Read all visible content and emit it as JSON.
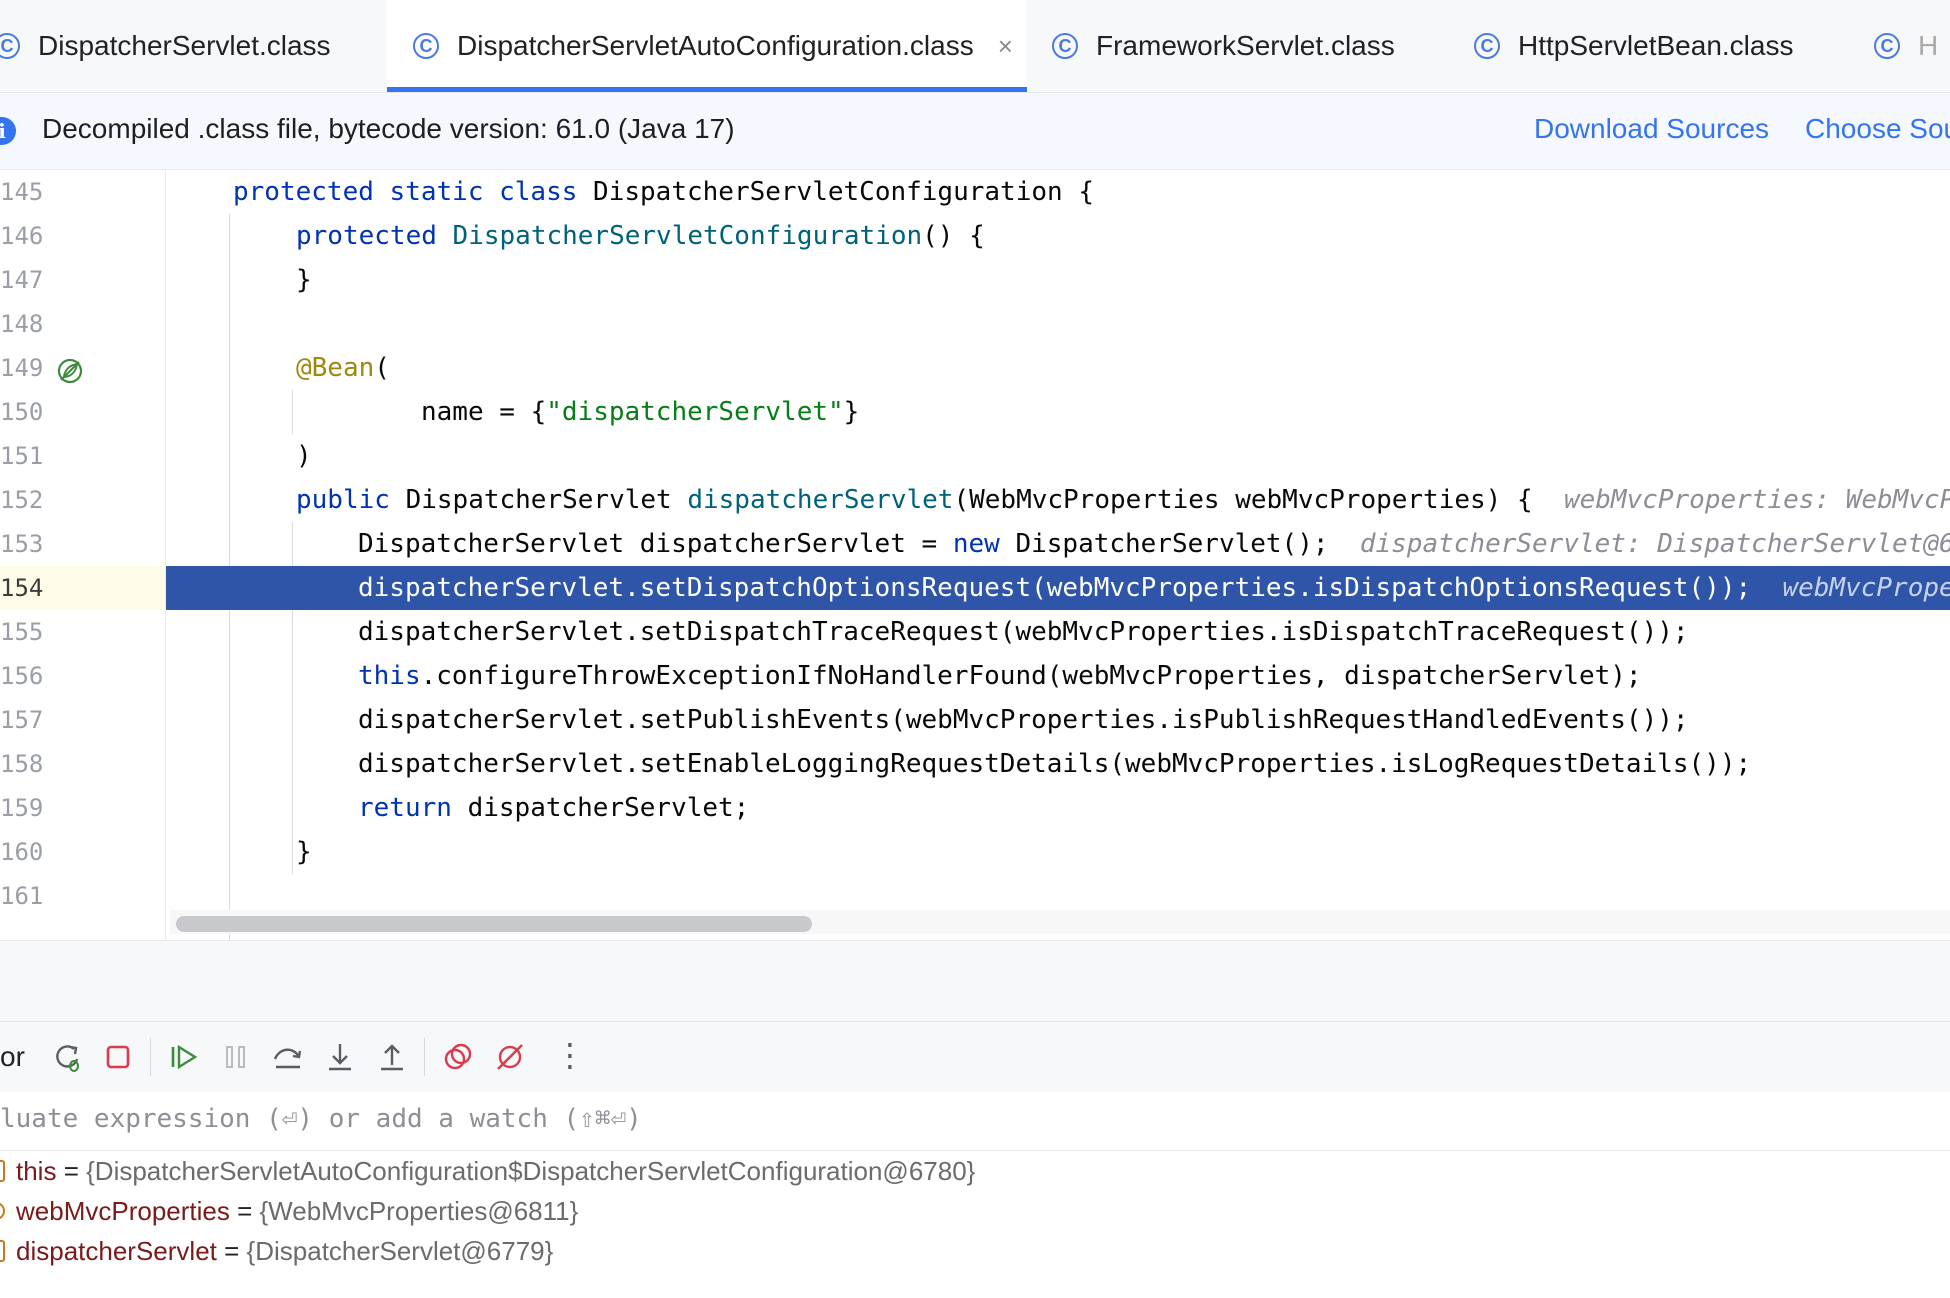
{
  "tabs": [
    {
      "label": "DispatcherServlet.class",
      "active": false
    },
    {
      "label": "DispatcherServletAutoConfiguration.class",
      "active": true,
      "close": "×"
    },
    {
      "label": "FrameworkServlet.class",
      "active": false
    },
    {
      "label": "HttpServletBean.class",
      "active": false
    },
    {
      "label": "H",
      "active": false
    }
  ],
  "banner": {
    "icon": "i",
    "text": "Decompiled .class file, bytecode version: 61.0 (Java 17)",
    "download_sources": "Download Sources",
    "choose_sources": "Choose Sou"
  },
  "editor": {
    "current_line": "154",
    "line_numbers": [
      "145",
      "146",
      "147",
      "148",
      "149",
      "150",
      "151",
      "152",
      "153",
      "154",
      "155",
      "156",
      "157",
      "158",
      "159",
      "160",
      "161"
    ],
    "lines": {
      "l145": {
        "kw1": "protected",
        "kw2": "static",
        "kw3": "class",
        "rest": " DispatcherServletConfiguration {"
      },
      "l146": {
        "kw1": "protected",
        "fn": "DispatcherServletConfiguration",
        "rest": "() {"
      },
      "l147": {
        "rest": "}"
      },
      "l149": {
        "ann": "@Bean",
        "rest": "("
      },
      "l150": {
        "pre": "name = {",
        "str": "\"dispatcherServlet\"",
        "post": "}"
      },
      "l151": {
        "rest": ")"
      },
      "l152": {
        "kw1": "public",
        "pre": " DispatcherServlet ",
        "fn": "dispatcherServlet",
        "post": "(WebMvcProperties webMvcProperties) {",
        "hint": "webMvcProperties: WebMvcP"
      },
      "l153": {
        "pre": "DispatcherServlet dispatcherServlet = ",
        "kw1": "new",
        "post": " DispatcherServlet();",
        "hint": "dispatcherServlet: DispatcherServlet@6"
      },
      "l154": {
        "rest": "dispatcherServlet.setDispatchOptionsRequest(webMvcProperties.isDispatchOptionsRequest());",
        "hint": "webMvcPrope"
      },
      "l155": {
        "rest": "dispatcherServlet.setDispatchTraceRequest(webMvcProperties.isDispatchTraceRequest());"
      },
      "l156": {
        "kw1": "this",
        "rest": ".configureThrowExceptionIfNoHandlerFound(webMvcProperties, dispatcherServlet);"
      },
      "l157": {
        "rest": "dispatcherServlet.setPublishEvents(webMvcProperties.isPublishRequestHandledEvents());"
      },
      "l158": {
        "rest": "dispatcherServlet.setEnableLoggingRequestDetails(webMvcProperties.isLogRequestDetails());"
      },
      "l159": {
        "kw1": "return",
        "rest": " dispatcherServlet;"
      },
      "l160": {
        "rest": "}"
      }
    }
  },
  "debugger": {
    "toolbar_label": "or",
    "toolbar_icons": [
      "rerun-debug-icon",
      "stop-icon",
      "resume-icon",
      "pause-icon",
      "step-over-icon",
      "step-into-icon",
      "step-out-icon",
      "view-breakpoints-icon",
      "mute-breakpoints-icon",
      "more-icon"
    ],
    "more_glyph": "⋮",
    "evaluate_placeholder": "luate expression (⏎) or add a watch (⇧⌘⏎)",
    "variables": [
      {
        "name": "this",
        "eq": " = ",
        "value": "{DispatcherServletAutoConfiguration$DispatcherServletConfiguration@6780}"
      },
      {
        "name": "webMvcProperties",
        "eq": " = ",
        "value": "{WebMvcProperties@6811}"
      },
      {
        "name": "dispatcherServlet",
        "eq": " = ",
        "value": "{DispatcherServlet@6779}"
      }
    ]
  },
  "colors": {
    "accent": "#3574f0",
    "selection": "#2e55a8",
    "keyword": "#0033b3",
    "string": "#067d17",
    "annotation": "#9e880d"
  }
}
